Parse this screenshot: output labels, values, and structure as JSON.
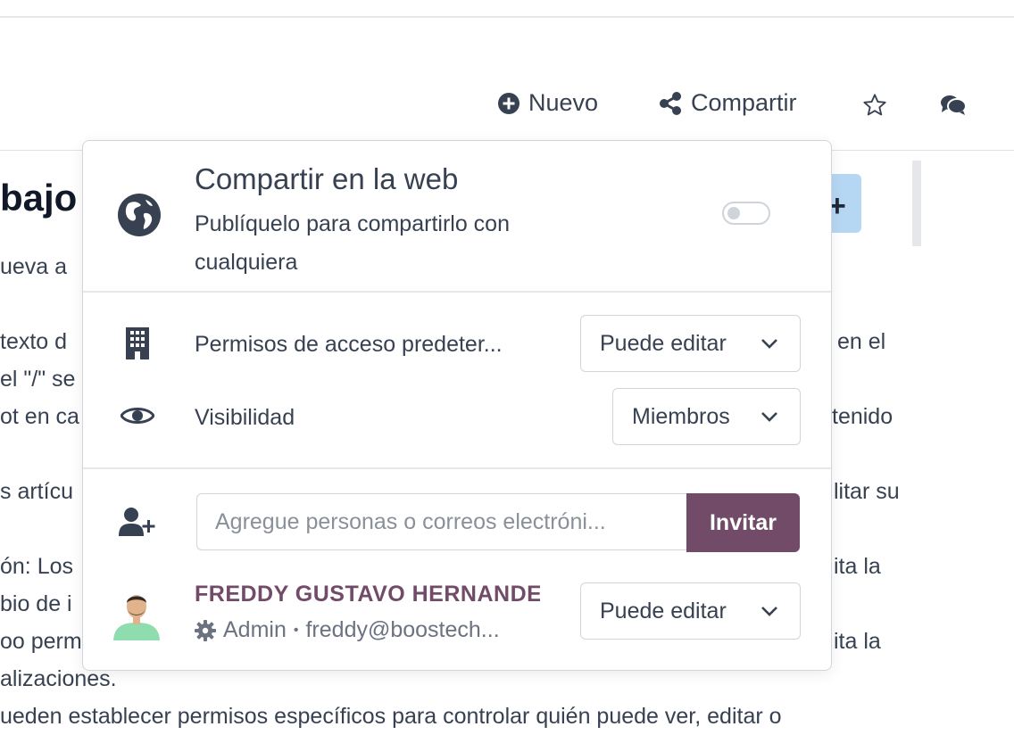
{
  "toolbar": {
    "new_label": "Nuevo",
    "share_label": "Compartir"
  },
  "background": {
    "heading": "bajo",
    "lines": [
      "ueva a",
      "texto d",
      "el \"/\" se",
      "ot en ca",
      "s artícu",
      "ón: Los",
      "bio de i",
      "oo perm",
      "alizaciones.",
      "ueden establecer permisos específicos para controlar quién puede ver, editar o"
    ],
    "right_lines": [
      "en el",
      "tenido",
      "litar su",
      "ita la",
      "ita la"
    ]
  },
  "share_popover": {
    "web": {
      "title": "Compartir en la web",
      "description": "Publíquelo para compartirlo con cualquiera",
      "published": false
    },
    "default_access": {
      "label": "Permisos de acceso predeter...",
      "value": "Puede editar"
    },
    "visibility": {
      "label": "Visibilidad",
      "value": "Miembros"
    },
    "invite": {
      "placeholder": "Agregue personas o correos electróni...",
      "button_label": "Invitar"
    },
    "members": [
      {
        "name": "FREDDY GUSTAVO HERNANDEZ",
        "role": "Admin",
        "separator": "•",
        "email": "freddy@boostech...",
        "permission": "Puede editar"
      }
    ]
  },
  "colors": {
    "accent": "#714b67",
    "text": "#374151",
    "border": "#d1d5db"
  }
}
